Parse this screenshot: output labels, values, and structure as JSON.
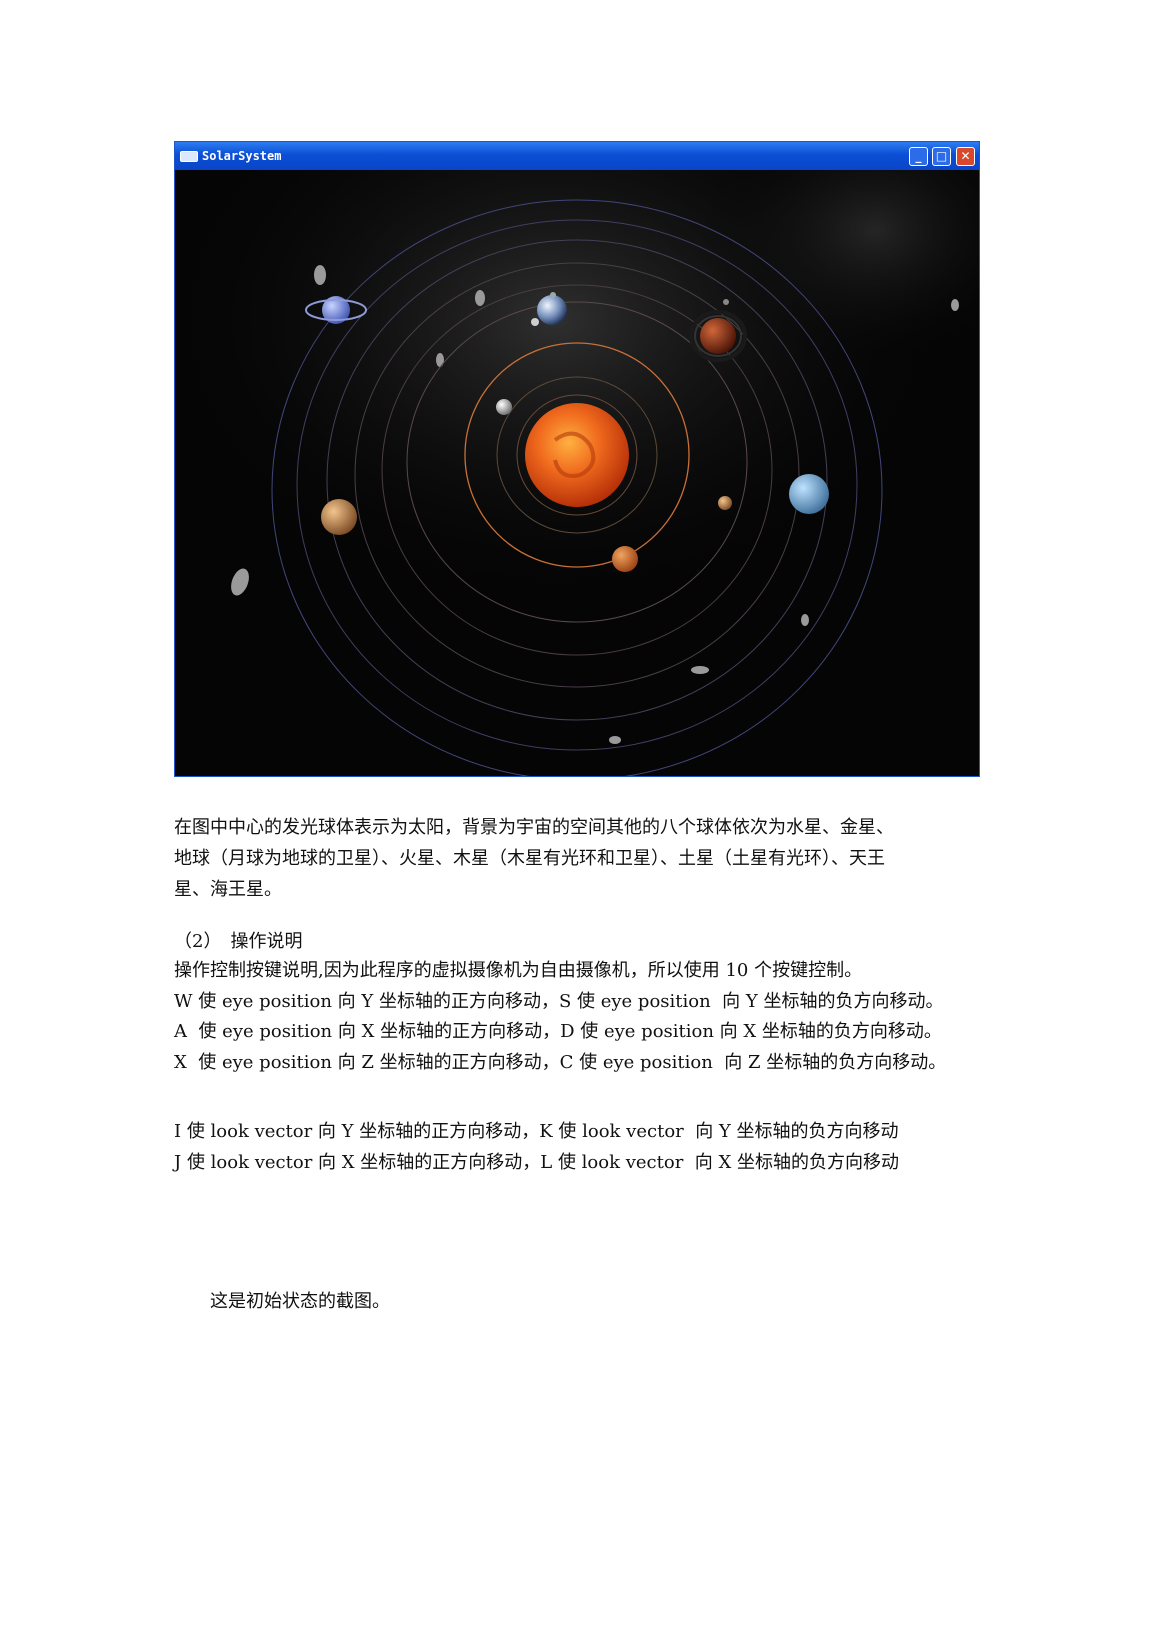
{
  "window": {
    "title": "SolarSystem",
    "min_glyph": "_",
    "max_glyph": "□",
    "close_glyph": "✕"
  },
  "description": {
    "line1": "在图中中心的发光球体表示为太阳，背景为宇宙的空间其他的八个球体依次为水星、金星、",
    "line2": "地球（月球为地球的卫星）、火星、木星（木星有光环和卫星）、土星（土星有光环）、天王",
    "line3": "星、海王星。"
  },
  "section": {
    "heading": "（2）　操作说明",
    "intro": "操作控制按键说明,因为此程序的虚拟摄像机为自由摄像机，所以使用 10 个按键控制。",
    "eye_lines": [
      "W 使 eye position 向 Y 坐标轴的正方向移动，S 使 eye position  向 Y 坐标轴的负方向移动。",
      "A  使 eye position 向 X 坐标轴的正方向移动，D 使 eye position 向 X 坐标轴的负方向移动。",
      "X  使 eye position 向 Z 坐标轴的正方向移动，C 使 eye position  向 Z 坐标轴的负方向移动。"
    ],
    "look_lines": [
      "I 使 look vector 向 Y 坐标轴的正方向移动，K 使 look vector  向 Y 坐标轴的负方向移动",
      "J 使 look vector 向 X 坐标轴的正方向移动，L 使 look vector  向 X 坐标轴的负方向移动"
    ]
  },
  "caption": "这是初始状态的截图。",
  "colors": {
    "titlebar": "#0b4fd6",
    "sun": "#e8561a",
    "orbit_inner": "#c96a3a",
    "orbit_outer": "#4d5fb5"
  }
}
